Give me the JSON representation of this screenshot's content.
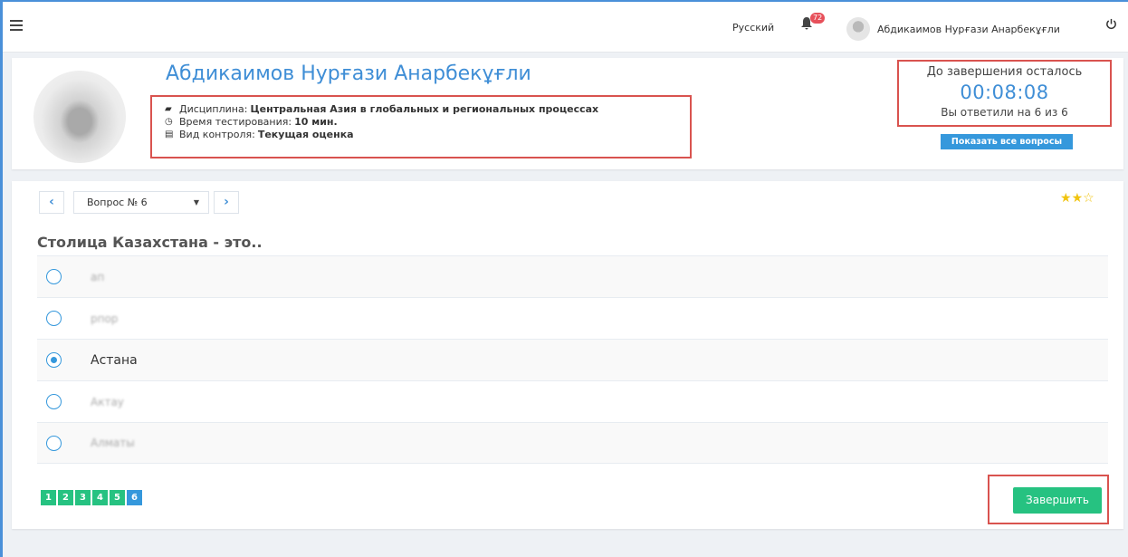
{
  "navbar": {
    "language": "Русский",
    "notification_count": "72",
    "user_name": "Абдикаимов Нурғази Анарбекұғли"
  },
  "profile": {
    "name": "Абдикаимов Нурғази Анарбекұғли",
    "discipline_label": "Дисциплина:",
    "discipline_value": "Центральная Азия в глобальных и региональных процессах",
    "time_label": "Время тестирования:",
    "time_value": "10 мин.",
    "control_label": "Вид контроля:",
    "control_value": "Текущая оценка"
  },
  "timer": {
    "label": "До завершения осталось",
    "value": "00:08:08",
    "answered": "Вы ответили на 6 из 6",
    "show_all_button": "Показать все вопросы"
  },
  "question": {
    "selector_label": "Вопрос № 6",
    "text": "Столица Казахстана - это..",
    "rating": {
      "filled": 2,
      "max": 3
    },
    "answers": [
      {
        "text": "ап",
        "selected": false
      },
      {
        "text": "рпор",
        "selected": false
      },
      {
        "text": "Астана",
        "selected": true
      },
      {
        "text": "Актау",
        "selected": false
      },
      {
        "text": "Алматы",
        "selected": false
      }
    ]
  },
  "pagination": [
    "1",
    "2",
    "3",
    "4",
    "5",
    "6"
  ],
  "pagination_active": "6",
  "finish_button": "Завершить",
  "colors": {
    "accent": "#3f8ed6",
    "button_blue": "#3598dc",
    "button_green": "#26c281",
    "highlight_red": "#d9534f",
    "star": "#f1c40f"
  }
}
